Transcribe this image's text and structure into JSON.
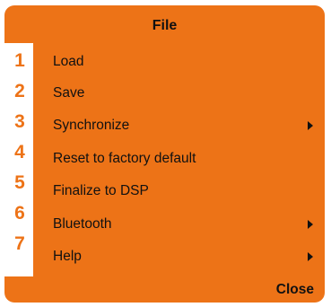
{
  "menu": {
    "title": "File",
    "close_label": "Close",
    "accent_color": "#ed7317",
    "items": [
      {
        "number": "1",
        "label": "Load",
        "has_submenu": false
      },
      {
        "number": "2",
        "label": "Save",
        "has_submenu": false
      },
      {
        "number": "3",
        "label": "Synchronize",
        "has_submenu": true,
        "icon": "chevron-right-icon"
      },
      {
        "number": "4",
        "label": "Reset to factory default",
        "has_submenu": false
      },
      {
        "number": "5",
        "label": "Finalize to DSP",
        "has_submenu": false
      },
      {
        "number": "6",
        "label": "Bluetooth",
        "has_submenu": true,
        "icon": "chevron-right-icon"
      },
      {
        "number": "7",
        "label": "Help",
        "has_submenu": true,
        "icon": "chevron-right-icon"
      }
    ]
  }
}
